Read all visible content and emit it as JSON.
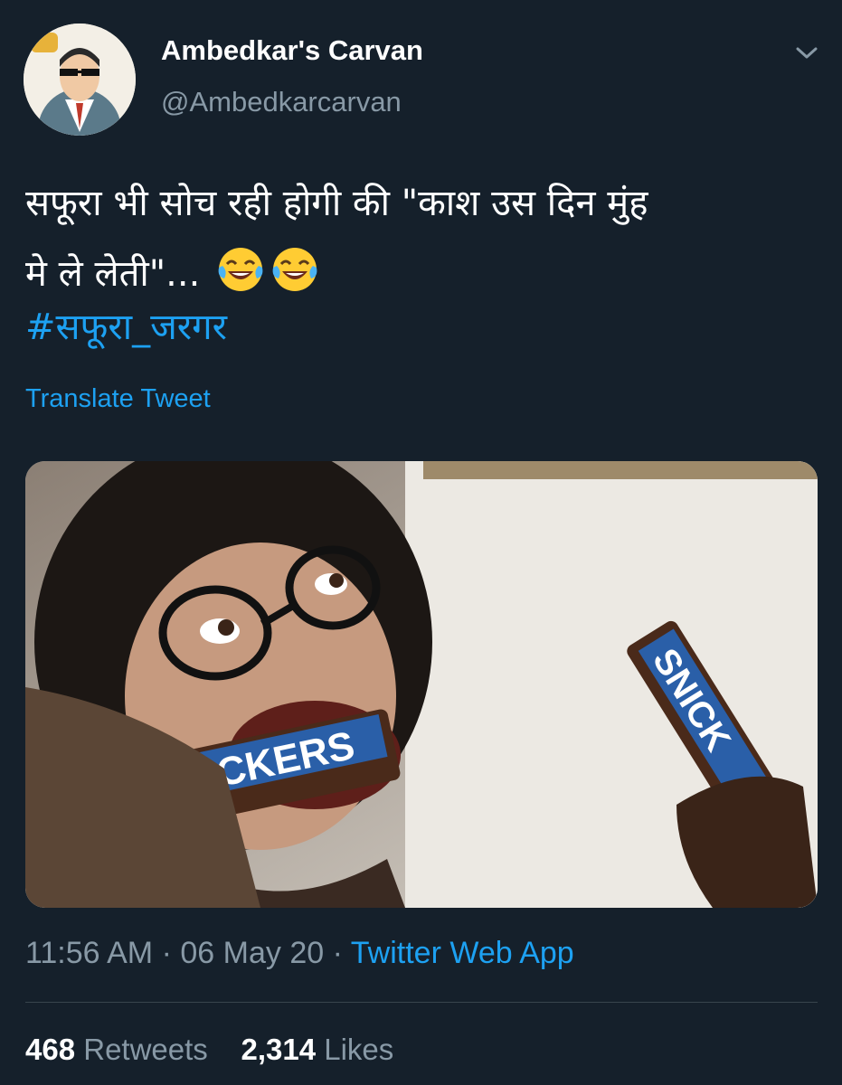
{
  "tweet": {
    "display_name": "Ambedkar's Carvan",
    "handle": "@Ambedkarcarvan",
    "caret_icon": "chevron-down-icon",
    "avatar_icon": "cartoon-portrait-avatar",
    "text_line1": "सफूरा भी सोच रही होगी की \"काश उस दिन मुंह",
    "text_line2": "मे ले लेती\"...",
    "emojis": [
      "face-with-tears-of-joy-icon",
      "face-with-tears-of-joy-icon"
    ],
    "hashtag": "#सफूरा_जरगर",
    "translate_label": "Translate Tweet",
    "media": {
      "wrapper_text_left": "ICKERS",
      "wrapper_text_right": "SNICK"
    },
    "time": "11:56 AM",
    "separator": "·",
    "date": "06 May 20",
    "source": "Twitter Web App",
    "retweets_count": "468",
    "retweets_label": "Retweets",
    "likes_count": "2,314",
    "likes_label": "Likes"
  },
  "colors": {
    "background": "#15202b",
    "link": "#1da1f2",
    "secondary_text": "#8899a6",
    "divider": "#38444d"
  }
}
